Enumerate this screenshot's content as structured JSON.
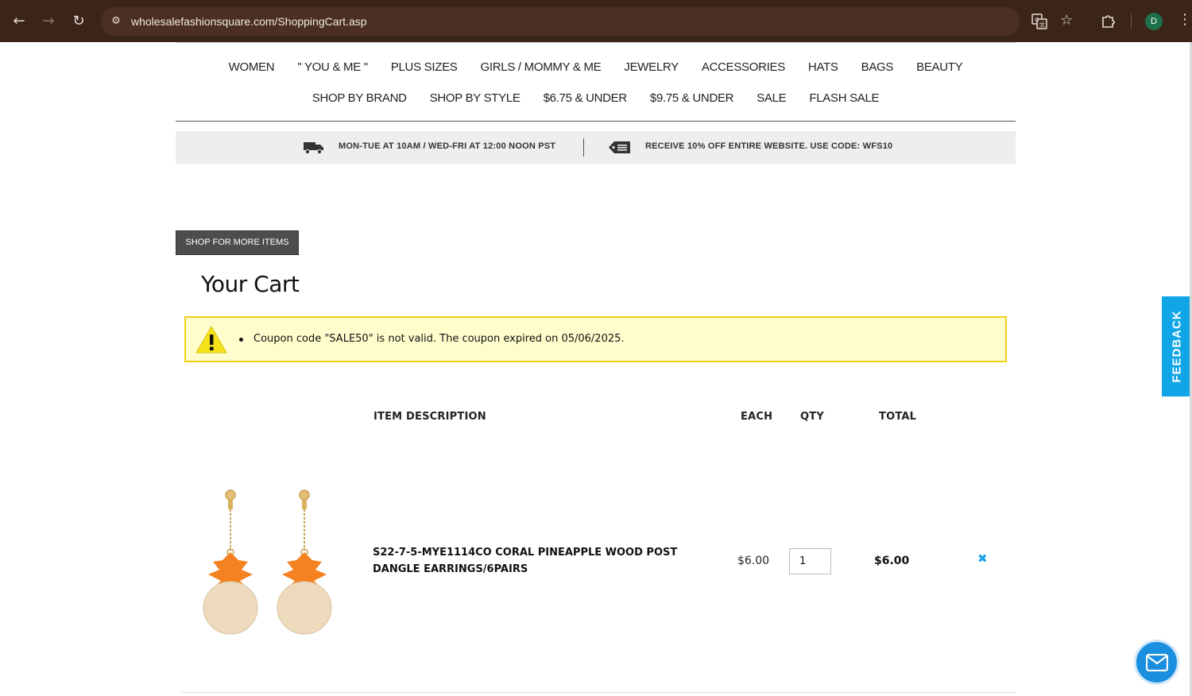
{
  "browser": {
    "url": "wholesalefashionsquare.com/ShoppingCart.asp",
    "profile_initial": "D"
  },
  "menu": {
    "row1": [
      "WOMEN",
      "\" YOU & ME \"",
      "PLUS SIZES",
      "GIRLS / MOMMY & ME",
      "JEWELRY",
      "ACCESSORIES",
      "HATS",
      "BAGS",
      "BEAUTY"
    ],
    "row2": [
      "SHOP BY BRAND",
      "SHOP BY STYLE",
      "$6.75 & UNDER",
      "$9.75 & UNDER",
      "SALE",
      "FLASH SALE"
    ]
  },
  "promo": {
    "shipping": "MON-TUE AT 10AM / WED-FRI AT 12:00 NOON PST",
    "discount": "RECEIVE 10% OFF ENTIRE WEBSITE. USE CODE: WFS10"
  },
  "shop_more_label": "SHOP FOR MORE ITEMS",
  "cart_title": "Your Cart",
  "alert_message": "Coupon code \"SALE50\" is not valid. The coupon expired on 05/06/2025.",
  "table_headers": {
    "description": "ITEM  DESCRIPTION",
    "each": "EACH",
    "qty": "QTY",
    "total": "TOTAL"
  },
  "items": [
    {
      "name": "S22-7-5-MYE1114CO CORAL PINEAPPLE WOOD POST DANGLE EARRINGS/6PAIRS",
      "each": "$6.00",
      "qty": "1",
      "total": "$6.00"
    }
  ],
  "feedback_label": "FEEDBACK",
  "colors": {
    "accent_blue": "#10a5e6",
    "alert_bg": "#fffdcc",
    "alert_border": "#f0cf1d",
    "browser_bar": "#3b2418"
  }
}
